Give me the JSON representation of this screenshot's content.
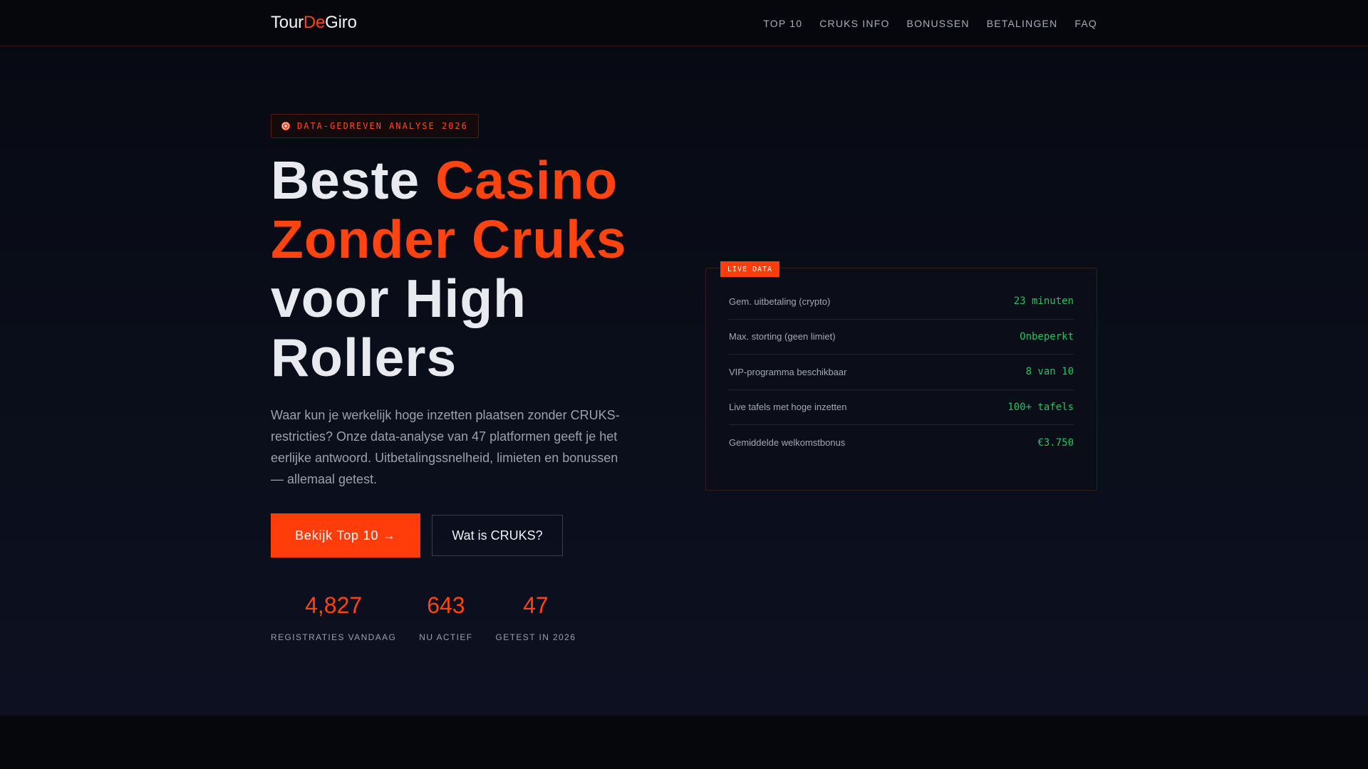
{
  "header": {
    "logo": {
      "part1": "Tour",
      "part2": "De",
      "part3": "Giro"
    },
    "nav": [
      "TOP 10",
      "CRUKS INFO",
      "BONUSSEN",
      "BETALINGEN",
      "FAQ"
    ]
  },
  "hero": {
    "badge": "DATA-GEDREVEN ANALYSE 2026",
    "headline": {
      "w1": "Beste",
      "w2": "Casino",
      "w3": "Zonder Cruks",
      "w4": "voor High",
      "w5": "Rollers"
    },
    "lead": "Waar kun je werkelijk hoge inzetten plaatsen zonder CRUKS-restricties? Onze data-analyse van 47 platformen geeft je het eerlijke antwoord. Uitbetalingssnelheid, limieten en bonussen — allemaal getest.",
    "primary_button": "Bekijk Top 10 →",
    "secondary_button": "Wat is CRUKS?",
    "stats": [
      {
        "value": "4,827",
        "label": "REGISTRATIES VANDAAG"
      },
      {
        "value": "643",
        "label": "NU ACTIEF"
      },
      {
        "value": "47",
        "label": "GETEST IN 2026"
      }
    ]
  },
  "panel": {
    "tag": "LIVE DATA",
    "rows": [
      {
        "key": "Gem. uitbetaling (crypto)",
        "value": "23 minuten"
      },
      {
        "key": "Max. storting (geen limiet)",
        "value": "Onbeperkt"
      },
      {
        "key": "VIP-programma beschikbaar",
        "value": "8 van 10"
      },
      {
        "key": "Live tafels met hoge inzetten",
        "value": "100+ tafels"
      },
      {
        "key": "Gemiddelde welkomstbonus",
        "value": "€3.750"
      }
    ]
  },
  "colors": {
    "accent": "#ff4412",
    "positive": "#22c55e",
    "background": "#05070d"
  },
  "icons": {
    "badge_icon": "target-icon"
  }
}
